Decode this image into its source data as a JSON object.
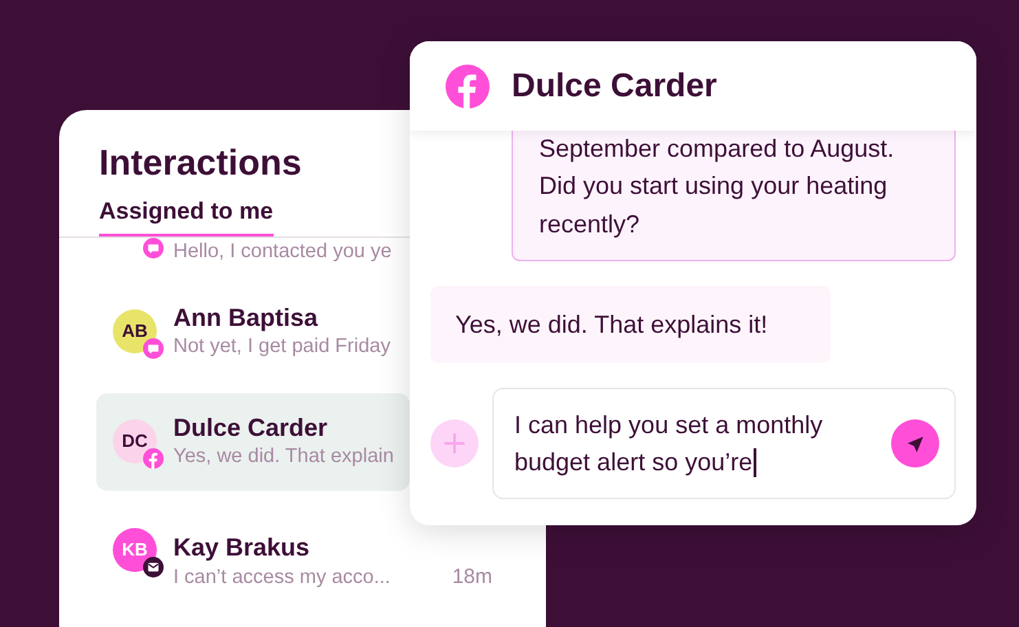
{
  "inbox": {
    "title": "Interactions",
    "tabs": [
      {
        "label": "Assigned to me",
        "selected": true
      }
    ],
    "conversations": [
      {
        "preview": "Hello, I contacted you ye",
        "kind": "sms",
        "selected": false
      },
      {
        "initials": "AB",
        "name": "Ann Baptisa",
        "preview": "Not yet, I get paid Friday",
        "kind": "sms",
        "selected": false,
        "color": "#e8e46a"
      },
      {
        "initials": "DC",
        "name": "Dulce Carder",
        "preview": "Yes, we did. That explain",
        "kind": "facebook",
        "selected": true,
        "color": "#fbd3ea"
      },
      {
        "initials": "KB",
        "name": "Kay Brakus",
        "preview": "I can’t access my acco...",
        "time": "18m",
        "kind": "email",
        "selected": false,
        "color": "#ff4fd8"
      }
    ]
  },
  "chat": {
    "title": "Dulce Carder",
    "messages": [
      {
        "kind": "outgoing",
        "text": "September compared to August. Did you start using your heating recently?"
      },
      {
        "kind": "incoming",
        "text": "Yes, we did. That explains it!"
      }
    ],
    "composer": {
      "value": "I can help you set a monthly budget alert so you’re"
    }
  }
}
